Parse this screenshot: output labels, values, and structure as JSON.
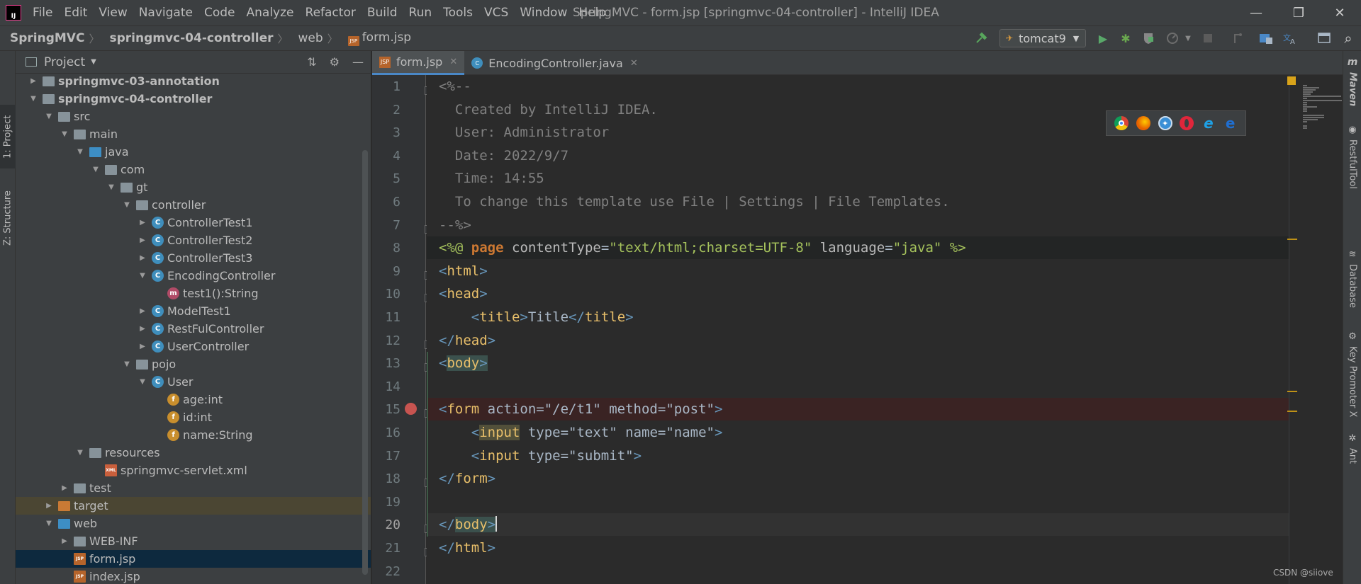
{
  "menubar": {
    "logo_text": "IJ",
    "items": [
      "File",
      "Edit",
      "View",
      "Navigate",
      "Code",
      "Analyze",
      "Refactor",
      "Build",
      "Run",
      "Tools",
      "VCS",
      "Window",
      "Help"
    ],
    "window_title": "SpringMVC - form.jsp [springmvc-04-controller] - IntelliJ IDEA",
    "minimize": "—",
    "restore": "❐",
    "close": "✕"
  },
  "navbar": {
    "crumbs": [
      "SpringMVC",
      "springmvc-04-controller",
      "web",
      "form.jsp"
    ],
    "jsp_badge": "JSP",
    "run_config": "tomcat9",
    "run_icon": "▶",
    "debug_icon": "✱",
    "search_icon": "⌕"
  },
  "left_strip": {
    "project_tab": "1: Project",
    "structure_tab": "Z: Structure"
  },
  "project_panel": {
    "title": "Project",
    "tree": [
      {
        "label": "springmvc-03-annotation",
        "depth": 1,
        "arrow": "▶",
        "icon": "module",
        "bold": true
      },
      {
        "label": "springmvc-04-controller",
        "depth": 1,
        "arrow": "▼",
        "icon": "module",
        "bold": true
      },
      {
        "label": "src",
        "depth": 2,
        "arrow": "▼",
        "icon": "folder"
      },
      {
        "label": "main",
        "depth": 3,
        "arrow": "▼",
        "icon": "folder"
      },
      {
        "label": "java",
        "depth": 4,
        "arrow": "▼",
        "icon": "folder-blue"
      },
      {
        "label": "com",
        "depth": 5,
        "arrow": "▼",
        "icon": "pkg"
      },
      {
        "label": "gt",
        "depth": 6,
        "arrow": "▼",
        "icon": "pkg"
      },
      {
        "label": "controller",
        "depth": 7,
        "arrow": "▼",
        "icon": "pkg"
      },
      {
        "label": "ControllerTest1",
        "depth": 8,
        "arrow": "▶",
        "icon": "cls"
      },
      {
        "label": "ControllerTest2",
        "depth": 8,
        "arrow": "▶",
        "icon": "cls"
      },
      {
        "label": "ControllerTest3",
        "depth": 8,
        "arrow": "▶",
        "icon": "cls"
      },
      {
        "label": "EncodingController",
        "depth": 8,
        "arrow": "▼",
        "icon": "cls"
      },
      {
        "label": "test1():String",
        "depth": 9,
        "arrow": "",
        "icon": "method"
      },
      {
        "label": "ModelTest1",
        "depth": 8,
        "arrow": "▶",
        "icon": "cls"
      },
      {
        "label": "RestFulController",
        "depth": 8,
        "arrow": "▶",
        "icon": "cls"
      },
      {
        "label": "UserController",
        "depth": 8,
        "arrow": "▶",
        "icon": "cls"
      },
      {
        "label": "pojo",
        "depth": 7,
        "arrow": "▼",
        "icon": "pkg"
      },
      {
        "label": "User",
        "depth": 8,
        "arrow": "▼",
        "icon": "cls"
      },
      {
        "label": "age:int",
        "depth": 9,
        "arrow": "",
        "icon": "field"
      },
      {
        "label": "id:int",
        "depth": 9,
        "arrow": "",
        "icon": "field"
      },
      {
        "label": "name:String",
        "depth": 9,
        "arrow": "",
        "icon": "field"
      },
      {
        "label": "resources",
        "depth": 4,
        "arrow": "▼",
        "icon": "folder"
      },
      {
        "label": "springmvc-servlet.xml",
        "depth": 5,
        "arrow": "",
        "icon": "xml"
      },
      {
        "label": "test",
        "depth": 3,
        "arrow": "▶",
        "icon": "folder"
      },
      {
        "label": "target",
        "depth": 2,
        "arrow": "▶",
        "icon": "folder-orange",
        "highlight": true
      },
      {
        "label": "web",
        "depth": 2,
        "arrow": "▼",
        "icon": "folder-blue"
      },
      {
        "label": "WEB-INF",
        "depth": 3,
        "arrow": "▶",
        "icon": "folder"
      },
      {
        "label": "form.jsp",
        "depth": 3,
        "arrow": "",
        "icon": "jsp",
        "selected": true
      },
      {
        "label": "index.jsp",
        "depth": 3,
        "arrow": "",
        "icon": "jsp"
      }
    ]
  },
  "editor": {
    "tabs": [
      {
        "label": "form.jsp",
        "icon": "jsp",
        "active": true
      },
      {
        "label": "EncodingController.java",
        "icon": "cls",
        "active": false
      }
    ],
    "tab_close": "✕",
    "current_line": 20,
    "breakpoint_line": 15,
    "lines": [
      {
        "n": "1",
        "text": "<%--"
      },
      {
        "n": "2",
        "text": "  Created by IntelliJ IDEA."
      },
      {
        "n": "3",
        "text": "  User: Administrator"
      },
      {
        "n": "4",
        "text": "  Date: 2022/9/7"
      },
      {
        "n": "5",
        "text": "  Time: 14:55"
      },
      {
        "n": "6",
        "text": "  To change this template use File | Settings | File Templates."
      },
      {
        "n": "7",
        "text": "--%>"
      },
      {
        "n": "8",
        "text": "<%@ page contentType=\"text/html;charset=UTF-8\" language=\"java\" %>"
      },
      {
        "n": "9",
        "text": "<html>"
      },
      {
        "n": "10",
        "text": "<head>"
      },
      {
        "n": "11",
        "text": "    <title>Title</title>"
      },
      {
        "n": "12",
        "text": "</head>"
      },
      {
        "n": "13",
        "text": "<body>"
      },
      {
        "n": "14",
        "text": ""
      },
      {
        "n": "15",
        "text": "<form action=\"/e/t1\" method=\"post\">"
      },
      {
        "n": "16",
        "text": "    <input type=\"text\" name=\"name\">"
      },
      {
        "n": "17",
        "text": "    <input type=\"submit\">"
      },
      {
        "n": "18",
        "text": "</form>"
      },
      {
        "n": "19",
        "text": ""
      },
      {
        "n": "20",
        "text": "</body>"
      },
      {
        "n": "21",
        "text": "</html>"
      },
      {
        "n": "22",
        "text": ""
      }
    ]
  },
  "browser_popup": {
    "browsers": [
      "chrome-icon",
      "firefox-icon",
      "safari-icon",
      "opera-icon",
      "ie-icon",
      "edge-icon"
    ]
  },
  "right_strip": {
    "tabs": [
      "Maven",
      "RestfulTool",
      "Database",
      "Key Promoter X",
      "Ant"
    ]
  },
  "watermark": "CSDN @siiove",
  "colors": {
    "accent": "#4a88c7",
    "tag": "#e8bf6a",
    "string": "#a5c25c",
    "keyword": "#cc7832",
    "comment": "#808080"
  }
}
